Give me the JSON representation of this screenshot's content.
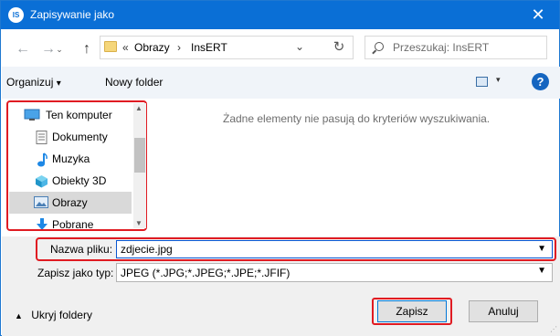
{
  "window": {
    "title": "Zapisywanie jako",
    "close": "✕",
    "app_icon": "IS"
  },
  "nav": {
    "back": "←",
    "forward": "→",
    "up": "↑"
  },
  "address": {
    "chevron": "«",
    "crumbs": [
      "Obrazy",
      "InsERT"
    ],
    "separator": "›",
    "dropdown": "⌄"
  },
  "refresh": "↻",
  "search": {
    "placeholder": "Przeszukaj: InsERT"
  },
  "toolbar": {
    "organize": "Organizuj",
    "organize_caret": "▾",
    "new_folder": "Nowy folder",
    "view_caret": "▾",
    "help": "?"
  },
  "sidebar": {
    "items": [
      {
        "label": "Ten komputer",
        "icon": "computer-icon"
      },
      {
        "label": "Dokumenty",
        "icon": "document-icon"
      },
      {
        "label": "Muzyka",
        "icon": "music-icon"
      },
      {
        "label": "Obiekty 3D",
        "icon": "cube-3d-icon"
      },
      {
        "label": "Obrazy",
        "icon": "pictures-icon",
        "selected": true
      },
      {
        "label": "Pobrane",
        "icon": "download-icon"
      }
    ]
  },
  "main": {
    "empty_message": "Żadne elementy nie pasują do kryteriów wyszukiwania."
  },
  "form": {
    "filename_label": "Nazwa pliku:",
    "filename_value": "zdjecie.jpg",
    "type_label": "Zapisz jako typ:",
    "type_value": "JPEG (*.JPG;*.JPEG;*.JPE;*.JFIF)"
  },
  "footer": {
    "hide_folders": "Ukryj foldery",
    "save": "Zapisz",
    "cancel": "Anuluj"
  },
  "colors": {
    "titlebar": "#0a6fd6",
    "highlight": "#e01b22",
    "selected": "#d9d9d9"
  }
}
